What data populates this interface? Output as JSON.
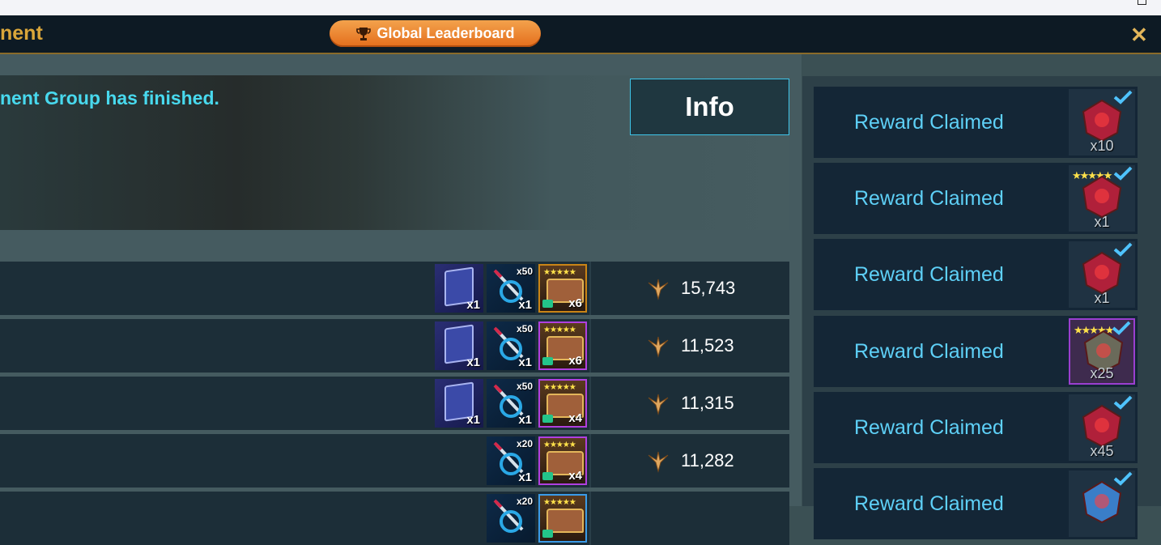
{
  "header": {
    "title": "nent",
    "leaderboard_button": "Global Leaderboard",
    "close_label": "✕"
  },
  "banner": {
    "message": "nent Group has finished.",
    "info_button": "Info"
  },
  "rows": [
    {
      "book_qty": "x1",
      "sword_top": "x50",
      "sword_qty": "x1",
      "chest_qty": "x6",
      "points": "15,743",
      "chest_border": "orange"
    },
    {
      "book_qty": "x1",
      "sword_top": "x50",
      "sword_qty": "x1",
      "chest_qty": "x6",
      "points": "11,523",
      "chest_border": "purple"
    },
    {
      "book_qty": "x1",
      "sword_top": "x50",
      "sword_qty": "x1",
      "chest_qty": "x4",
      "points": "11,315",
      "chest_border": "purple"
    },
    {
      "book_qty": null,
      "sword_top": "x20",
      "sword_qty": "x1",
      "chest_qty": "x4",
      "points": "11,282",
      "chest_border": "purple"
    },
    {
      "book_qty": null,
      "sword_top": "x20",
      "sword_qty": "",
      "chest_qty": "",
      "points": "",
      "chest_border": "blue"
    }
  ],
  "rewards": [
    {
      "label": "Reward Claimed",
      "qty": "x10",
      "icon": "red-shard-medallion-icon"
    },
    {
      "label": "Reward Claimed",
      "qty": "x1",
      "icon": "five-star-crystal-icon"
    },
    {
      "label": "Reward Claimed",
      "qty": "x1",
      "icon": "red-potion-icon"
    },
    {
      "label": "Reward Claimed",
      "qty": "x25",
      "icon": "champion-fragment-icon"
    },
    {
      "label": "Reward Claimed",
      "qty": "x45",
      "icon": "red-crystal-icon"
    },
    {
      "label": "Reward Claimed",
      "qty": "",
      "icon": "blue-crystal-icon"
    }
  ],
  "colors": {
    "accent_orange": "#e46e1c",
    "title_gold": "#d9a63a",
    "cyan_text": "#48d9ee",
    "reward_text": "#5ed0f7"
  }
}
